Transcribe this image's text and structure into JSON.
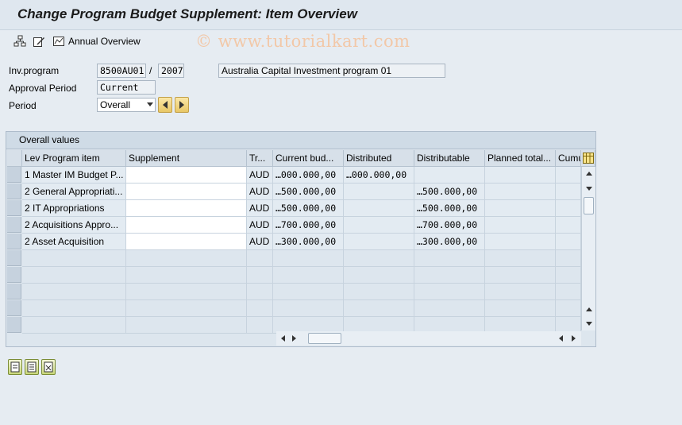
{
  "window": {
    "title": "Change Program Budget Supplement: Item Overview"
  },
  "toolbar": {
    "annual_overview_label": "Annual Overview",
    "icons": [
      "hierarchy-icon",
      "edit-icon",
      "annual-overview-icon"
    ]
  },
  "watermark": "© www.tutorialkart.com",
  "header_fields": {
    "inv_program_label": "Inv.program",
    "inv_program_value": "8500AU01",
    "separator": "/",
    "year_value": "2007",
    "description": "Australia Capital Investment program 01",
    "approval_period_label": "Approval Period",
    "approval_period_value": "Current",
    "period_label": "Period",
    "period_value": "Overall"
  },
  "grid": {
    "title": "Overall values",
    "columns": [
      "Lev Program item",
      "Supplement",
      "Tr...",
      "Current bud...",
      "Distributed",
      "Distributable",
      "Planned total...",
      "Cumu"
    ],
    "rows": [
      [
        "1 Master IM Budget P...",
        "",
        "AUD",
        "…000.000,00",
        "…000.000,00",
        ""
      ],
      [
        "2  General Appropriati...",
        "",
        "AUD",
        "…500.000,00",
        "",
        "…500.000,00"
      ],
      [
        "2  IT Appropriations",
        "",
        "AUD",
        "…500.000,00",
        "",
        "…500.000,00"
      ],
      [
        "2  Acquisitions Appro...",
        "",
        "AUD",
        "…700.000,00",
        "",
        "…700.000,00"
      ],
      [
        "2  Asset Acquisition",
        "",
        "AUD",
        "…300.000,00",
        "",
        "…300.000,00"
      ]
    ]
  },
  "colors": {
    "nav_button": "#e8c766",
    "background": "#e6ecf2"
  }
}
